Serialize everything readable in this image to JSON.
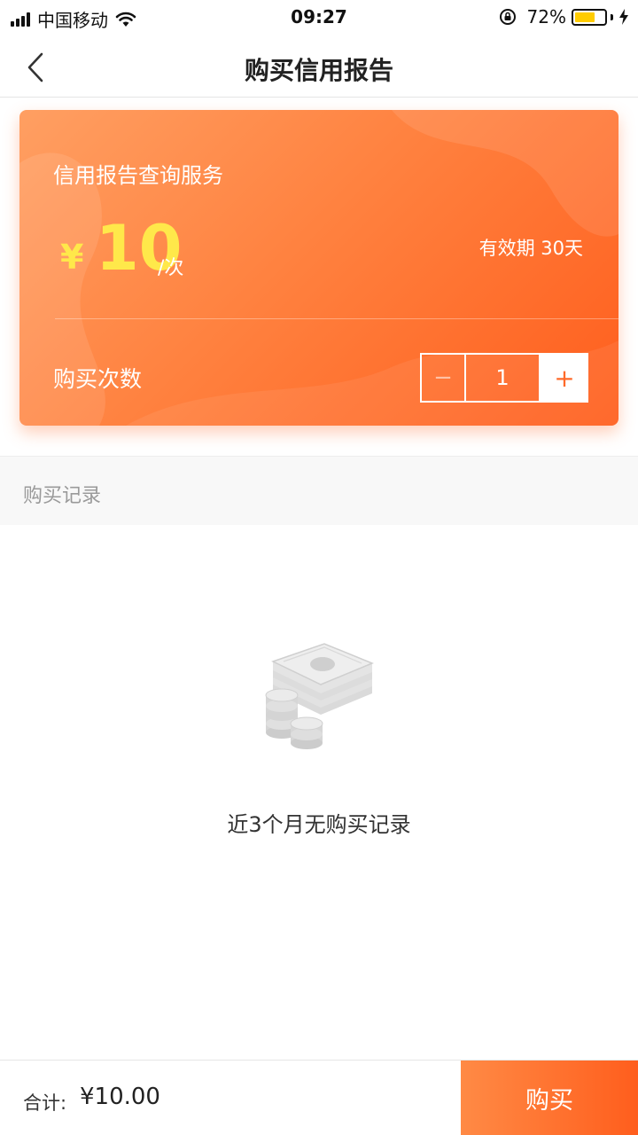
{
  "status_bar": {
    "carrier": "中国移动",
    "time": "09:27",
    "battery_percent": "72%",
    "battery_level": 0.72,
    "battery_color": "#ffcc00"
  },
  "nav": {
    "title": "购买信用报告",
    "back_icon": "chevron-left-icon"
  },
  "card": {
    "service_name": "信用报告查询服务",
    "price_symbol": "¥",
    "price": "10",
    "price_unit": "/次",
    "validity": "有效期 30天",
    "quantity_label": "购买次数",
    "quantity": "1",
    "minus_label": "−",
    "plus_label": "+",
    "accent_color": "#ff6a2a",
    "price_color": "#ffe84a"
  },
  "records": {
    "title": "购买记录",
    "empty_text": "近3个月无购买记录",
    "empty_icon": "money-stack-icon"
  },
  "footer": {
    "total_label": "合计:",
    "total_value": "¥10.00",
    "buy_label": "购买"
  }
}
